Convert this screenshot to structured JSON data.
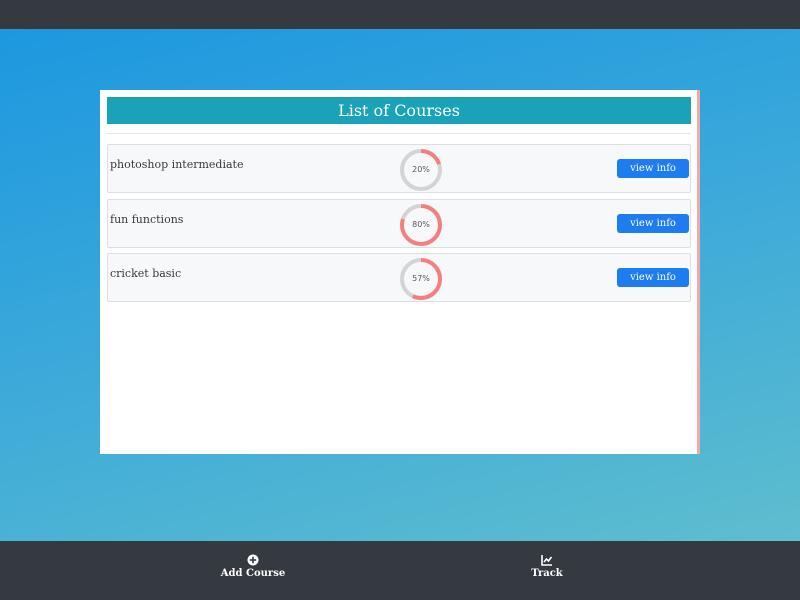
{
  "panel": {
    "title": "List of Courses"
  },
  "courses": [
    {
      "name": "photoshop intermediate",
      "progress_label": "20%",
      "progress": 0.2,
      "button_label": "view info"
    },
    {
      "name": "fun functions",
      "progress_label": "80%",
      "progress": 0.8,
      "button_label": "view info"
    },
    {
      "name": "cricket basic",
      "progress_label": "57%",
      "progress": 0.57,
      "button_label": "view info"
    }
  ],
  "bottom_nav": {
    "add_course": {
      "label": "Add Course",
      "icon": "plus-circle-icon"
    },
    "track": {
      "label": "Track",
      "icon": "chart-line-icon"
    }
  },
  "colors": {
    "header_bg": "#1aa3b8",
    "button_bg": "#1c7cf0",
    "progress_fill": "#f57f7f",
    "progress_track": "#d4d4d4",
    "bar_bg": "#343a40"
  }
}
